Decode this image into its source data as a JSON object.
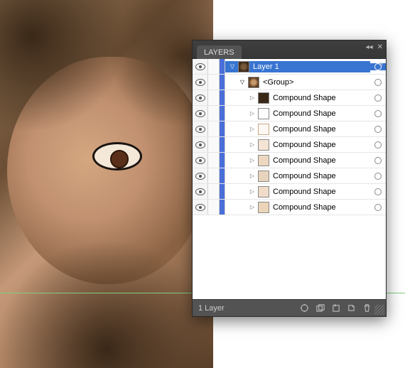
{
  "panel": {
    "tab_label": "LAYERS",
    "status_text": "1 Layer"
  },
  "rows": [
    {
      "indent": 0,
      "disclosure": "down",
      "thumb": "layer",
      "label": "Layer 1",
      "selected": true
    },
    {
      "indent": 1,
      "disclosure": "down",
      "thumb": "group",
      "label": "<Group>",
      "selected": false
    },
    {
      "indent": 2,
      "disclosure": "right",
      "thumb": "shape1",
      "label": "Compound Shape",
      "selected": false
    },
    {
      "indent": 2,
      "disclosure": "right",
      "thumb": "shape2",
      "label": "Compound Shape",
      "selected": false
    },
    {
      "indent": 2,
      "disclosure": "right",
      "thumb": "shape3",
      "label": "Compound Shape",
      "selected": false
    },
    {
      "indent": 2,
      "disclosure": "right",
      "thumb": "shape4",
      "label": "Compound Shape",
      "selected": false
    },
    {
      "indent": 2,
      "disclosure": "right",
      "thumb": "shape5",
      "label": "Compound Shape",
      "selected": false
    },
    {
      "indent": 2,
      "disclosure": "right",
      "thumb": "shape6",
      "label": "Compound Shape",
      "selected": false
    },
    {
      "indent": 2,
      "disclosure": "right",
      "thumb": "shape7",
      "label": "Compound Shape",
      "selected": false
    },
    {
      "indent": 2,
      "disclosure": "right",
      "thumb": "shape8",
      "label": "Compound Shape",
      "selected": false
    }
  ],
  "icons": {
    "collapse": "◂◂",
    "close": "✕",
    "menu": "≡"
  },
  "status_buttons": [
    "locate-object",
    "clipping-mask",
    "sublayer",
    "new-layer",
    "delete"
  ]
}
